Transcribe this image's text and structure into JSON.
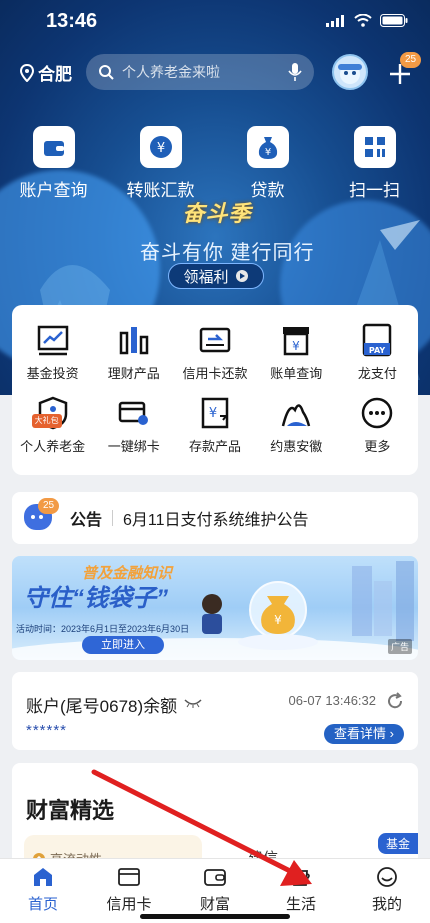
{
  "status": {
    "time": "13:46"
  },
  "topbar": {
    "location": "合肥",
    "search_placeholder": "个人养老金来啦",
    "message_count": "25"
  },
  "quick_actions": [
    {
      "label": "账户查询",
      "icon": "wallet-icon"
    },
    {
      "label": "转账汇款",
      "icon": "transfer-icon"
    },
    {
      "label": "贷款",
      "icon": "money-bag-icon"
    },
    {
      "label": "扫一扫",
      "icon": "scan-icon"
    }
  ],
  "promo": {
    "logo": "奋斗季",
    "slogan": "奋斗有你 建行同行",
    "button": "领福利"
  },
  "services": [
    {
      "label": "基金投资",
      "icon": "chart-icon"
    },
    {
      "label": "理财产品",
      "icon": "bar-chart-icon"
    },
    {
      "label": "信用卡还款",
      "icon": "card-repay-icon"
    },
    {
      "label": "账单查询",
      "icon": "bill-icon"
    },
    {
      "label": "龙支付",
      "icon": "pay-icon"
    },
    {
      "label": "个人养老金",
      "icon": "pension-icon",
      "badge": "大礼包"
    },
    {
      "label": "一键绑卡",
      "icon": "bind-card-icon"
    },
    {
      "label": "存款产品",
      "icon": "deposit-icon"
    },
    {
      "label": "约惠安徽",
      "icon": "mountain-icon"
    },
    {
      "label": "更多",
      "icon": "more-icon"
    }
  ],
  "notice": {
    "count": "25",
    "title": "公告",
    "text": "6月11日支付系统维护公告"
  },
  "banner": {
    "subtitle": "普及金融知识",
    "title": "守住“钱袋子”",
    "date": "活动时间：2023年6月1日至2023年6月30日",
    "button": "立即进入",
    "ad": "广告"
  },
  "account": {
    "title": "账户(尾号0678)余额",
    "time": "06-07 13:46:32",
    "balance": "******",
    "detail_button": "查看详情"
  },
  "wealth": {
    "title": "财富精选",
    "card_tag": "高流动性",
    "fund_tag": "基金",
    "product_name": "建信..."
  },
  "tabs": [
    {
      "label": "首页",
      "active": true
    },
    {
      "label": "信用卡",
      "active": false
    },
    {
      "label": "财富",
      "active": false
    },
    {
      "label": "生活",
      "active": false
    },
    {
      "label": "我的",
      "active": false
    }
  ],
  "colors": {
    "brand": "#2a62d0",
    "arrow": "#e02020",
    "badge": "#f29a45"
  }
}
